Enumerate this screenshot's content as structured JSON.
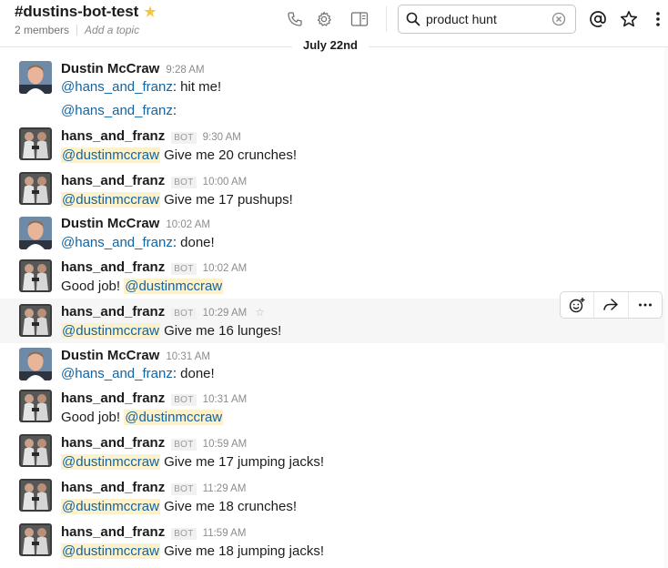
{
  "channel": {
    "name": "#dustins-bot-test",
    "members": "2 members",
    "topic": "Add a topic"
  },
  "search": {
    "value": "product hunt"
  },
  "date_divider": "July 22nd",
  "icons": {
    "star_filled": "★",
    "star_outline": "☆"
  },
  "colors": {
    "mention": "#1264a3",
    "mention_highlight": "#fcf1cb",
    "star": "#f2c744",
    "hover_row": "#f6f6f6"
  },
  "messages": [
    {
      "user": "Dustin McCraw",
      "time": "9:28 AM",
      "bot": "",
      "mention": "@hans_and_franz",
      "text": ": hit me!"
    },
    {
      "user": "",
      "time": "",
      "bot": "",
      "mention": "@hans_and_franz",
      "text": ":"
    },
    {
      "user": "hans_and_franz",
      "time": "9:30 AM",
      "bot": "BOT",
      "mention": "@dustinmccraw",
      "text": " Give me 20 crunches!"
    },
    {
      "user": "hans_and_franz",
      "time": "10:00 AM",
      "bot": "BOT",
      "mention": "@dustinmccraw",
      "text": " Give me 17 pushups!"
    },
    {
      "user": "Dustin McCraw",
      "time": "10:02 AM",
      "bot": "",
      "mention": "@hans_and_franz",
      "text": ": done!"
    },
    {
      "user": "hans_and_franz",
      "time": "10:02 AM",
      "bot": "BOT",
      "prefix": "Good job! ",
      "mention": "@dustinmccraw",
      "text": ""
    },
    {
      "user": "hans_and_franz",
      "time": "10:29 AM",
      "bot": "BOT",
      "mention": "@dustinmccraw",
      "text": " Give me 16 lunges!"
    },
    {
      "user": "Dustin McCraw",
      "time": "10:31 AM",
      "bot": "",
      "mention": "@hans_and_franz",
      "text": ": done!"
    },
    {
      "user": "hans_and_franz",
      "time": "10:31 AM",
      "bot": "BOT",
      "prefix": "Good job! ",
      "mention": "@dustinmccraw",
      "text": ""
    },
    {
      "user": "hans_and_franz",
      "time": "10:59 AM",
      "bot": "BOT",
      "mention": "@dustinmccraw",
      "text": " Give me 17 jumping jacks!"
    },
    {
      "user": "hans_and_franz",
      "time": "11:29 AM",
      "bot": "BOT",
      "mention": "@dustinmccraw",
      "text": " Give me 18 crunches!"
    },
    {
      "user": "hans_and_franz",
      "time": "11:59 AM",
      "bot": "BOT",
      "mention": "@dustinmccraw",
      "text": " Give me 18 jumping jacks!"
    }
  ]
}
